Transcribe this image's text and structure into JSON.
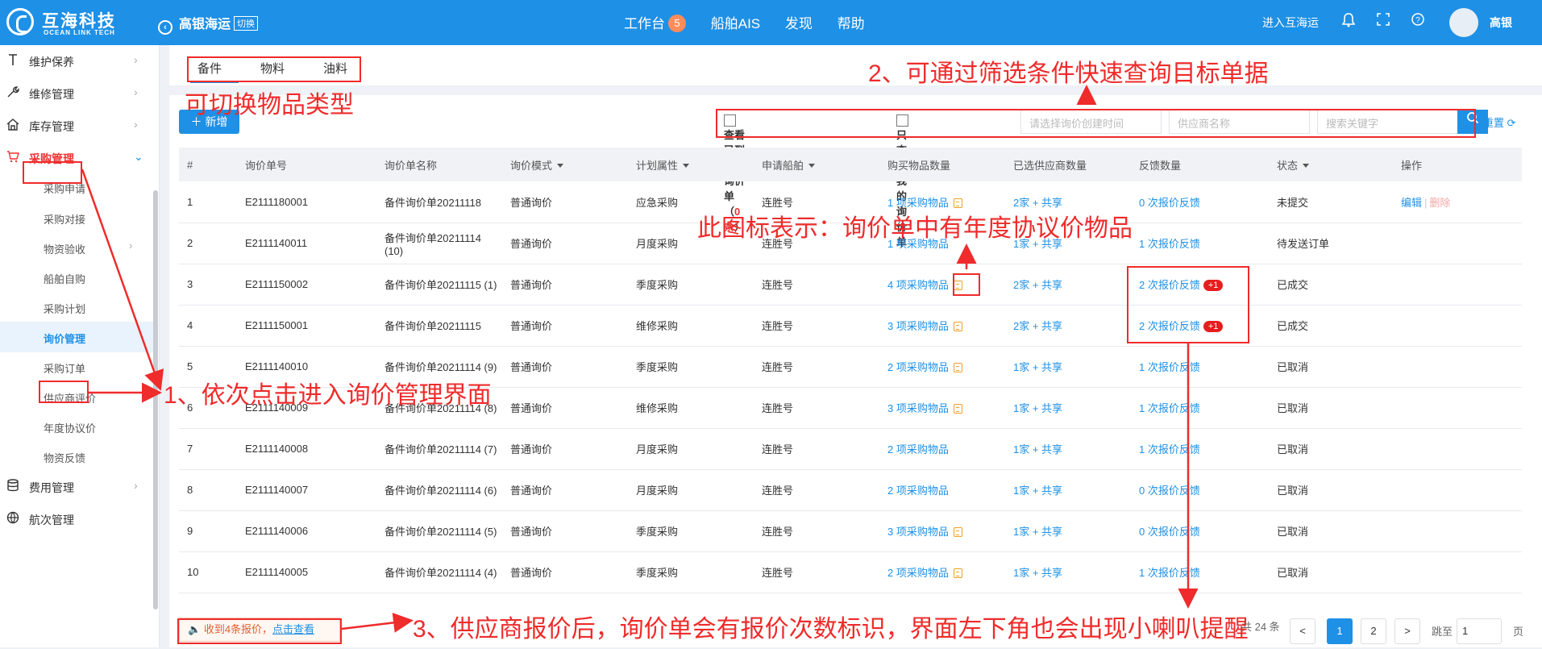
{
  "topbar": {
    "logo_cn": "互海科技",
    "logo_en": "OCEAN LINK TECH",
    "company": "高银海运",
    "switch_label": "切换",
    "nav": [
      "工作台",
      "船舶AIS",
      "发现",
      "帮助"
    ],
    "workbench_badge": "5",
    "enter_label": "进入互海运",
    "user_name": "高银"
  },
  "sidebar": {
    "items": [
      {
        "label": "维护保养",
        "icon": "wrench-icon"
      },
      {
        "label": "维修管理",
        "icon": "tool-icon"
      },
      {
        "label": "库存管理",
        "icon": "home-icon"
      },
      {
        "label": "采购管理",
        "icon": "cart-icon"
      }
    ],
    "subitems": [
      "采购申请",
      "采购对接",
      "物资验收",
      "船舶自购",
      "采购计划",
      "询价管理",
      "采购订单",
      "供应商评价",
      "年度协议价",
      "物资反馈"
    ],
    "bottom_items": [
      {
        "label": "费用管理",
        "icon": "database-icon"
      },
      {
        "label": "航次管理",
        "icon": "globe-icon"
      }
    ]
  },
  "tabs": [
    "备件",
    "物料",
    "油料"
  ],
  "toolbar": {
    "new_label": "新增",
    "chk_expired_label": "查看已到期的询价单（",
    "chk_expired_count": "0条",
    "chk_expired_tail": "）",
    "chk_mine_label": "只查看我的询价单",
    "date_placeholder": "请选择询价创建时间",
    "supplier_placeholder": "供应商名称",
    "keyword_placeholder": "搜索关键字",
    "reset_label": "重置"
  },
  "table": {
    "headers": [
      "#",
      "询价单号",
      "询价单名称",
      "询价模式",
      "计划属性",
      "申请船舶",
      "购买物品数量",
      "已选供应商数量",
      "反馈数量",
      "状态",
      "操作"
    ],
    "rows": [
      {
        "n": "1",
        "no": "E2111180001",
        "name": "备件询价单20211118",
        "mode": "普通询价",
        "plan": "应急采购",
        "ship": "连胜号",
        "items": "1 项采购物品",
        "agree": true,
        "supp": "2家 + 共享",
        "fb": "0 次报价反馈",
        "plus": "",
        "status": "未提交",
        "edit": "编辑",
        "del": "删除"
      },
      {
        "n": "2",
        "no": "E2111140011",
        "name": "备件询价单20211114 (10)",
        "mode": "普通询价",
        "plan": "月度采购",
        "ship": "连胜号",
        "items": "1 项采购物品",
        "agree": false,
        "supp": "1家 + 共享",
        "fb": "1 次报价反馈",
        "plus": "",
        "status": "待发送订单",
        "edit": "",
        "del": ""
      },
      {
        "n": "3",
        "no": "E2111150002",
        "name": "备件询价单20211115 (1)",
        "mode": "普通询价",
        "plan": "季度采购",
        "ship": "连胜号",
        "items": "4 项采购物品",
        "agree": true,
        "supp": "2家 + 共享",
        "fb": "2 次报价反馈",
        "plus": "+1",
        "status": "已成交",
        "edit": "",
        "del": ""
      },
      {
        "n": "4",
        "no": "E2111150001",
        "name": "备件询价单20211115",
        "mode": "普通询价",
        "plan": "维修采购",
        "ship": "连胜号",
        "items": "3 项采购物品",
        "agree": true,
        "supp": "2家 + 共享",
        "fb": "2 次报价反馈",
        "plus": "+1",
        "status": "已成交",
        "edit": "",
        "del": ""
      },
      {
        "n": "5",
        "no": "E2111140010",
        "name": "备件询价单20211114 (9)",
        "mode": "普通询价",
        "plan": "季度采购",
        "ship": "连胜号",
        "items": "2 项采购物品",
        "agree": true,
        "supp": "1家 + 共享",
        "fb": "1 次报价反馈",
        "plus": "",
        "status": "已取消",
        "edit": "",
        "del": ""
      },
      {
        "n": "6",
        "no": "E2111140009",
        "name": "备件询价单20211114 (8)",
        "mode": "普通询价",
        "plan": "维修采购",
        "ship": "连胜号",
        "items": "3 项采购物品",
        "agree": true,
        "supp": "1家 + 共享",
        "fb": "1 次报价反馈",
        "plus": "",
        "status": "已取消",
        "edit": "",
        "del": ""
      },
      {
        "n": "7",
        "no": "E2111140008",
        "name": "备件询价单20211114 (7)",
        "mode": "普通询价",
        "plan": "月度采购",
        "ship": "连胜号",
        "items": "2 项采购物品",
        "agree": false,
        "supp": "1家 + 共享",
        "fb": "1 次报价反馈",
        "plus": "",
        "status": "已取消",
        "edit": "",
        "del": ""
      },
      {
        "n": "8",
        "no": "E2111140007",
        "name": "备件询价单20211114 (6)",
        "mode": "普通询价",
        "plan": "月度采购",
        "ship": "连胜号",
        "items": "2 项采购物品",
        "agree": false,
        "supp": "1家 + 共享",
        "fb": "0 次报价反馈",
        "plus": "",
        "status": "已取消",
        "edit": "",
        "del": ""
      },
      {
        "n": "9",
        "no": "E2111140006",
        "name": "备件询价单20211114 (5)",
        "mode": "普通询价",
        "plan": "季度采购",
        "ship": "连胜号",
        "items": "3 项采购物品",
        "agree": true,
        "supp": "1家 + 共享",
        "fb": "0 次报价反馈",
        "plus": "",
        "status": "已取消",
        "edit": "",
        "del": ""
      },
      {
        "n": "10",
        "no": "E2111140005",
        "name": "备件询价单20211114 (4)",
        "mode": "普通询价",
        "plan": "季度采购",
        "ship": "连胜号",
        "items": "2 项采购物品",
        "agree": true,
        "supp": "1家 + 共享",
        "fb": "1 次报价反馈",
        "plus": "",
        "status": "已取消",
        "edit": "",
        "del": ""
      }
    ]
  },
  "footer": {
    "notice_text": "收到4条报价，",
    "notice_link": "点击查看",
    "total": "共 24 条",
    "pages": [
      "1",
      "2"
    ],
    "next": ">",
    "prev": "<",
    "jump_label": "跳至",
    "jump_value": "1",
    "page_unit": "页"
  },
  "annotations": {
    "a1": "1、依次点击进入询价管理界面",
    "a2": "2、可通过筛选条件快速查询目标单据",
    "a3": "3、供应商报价后，询价单会有报价次数标识，界面左下角也会出现小喇叭提醒",
    "tab_note": "可切换物品类型",
    "icon_note": "此图标表示：询价单中有年度协议价物品"
  },
  "colors": {
    "primary": "#1e90e6",
    "annotation": "#ef2b2b",
    "plus_badge": "#e61e1e"
  }
}
